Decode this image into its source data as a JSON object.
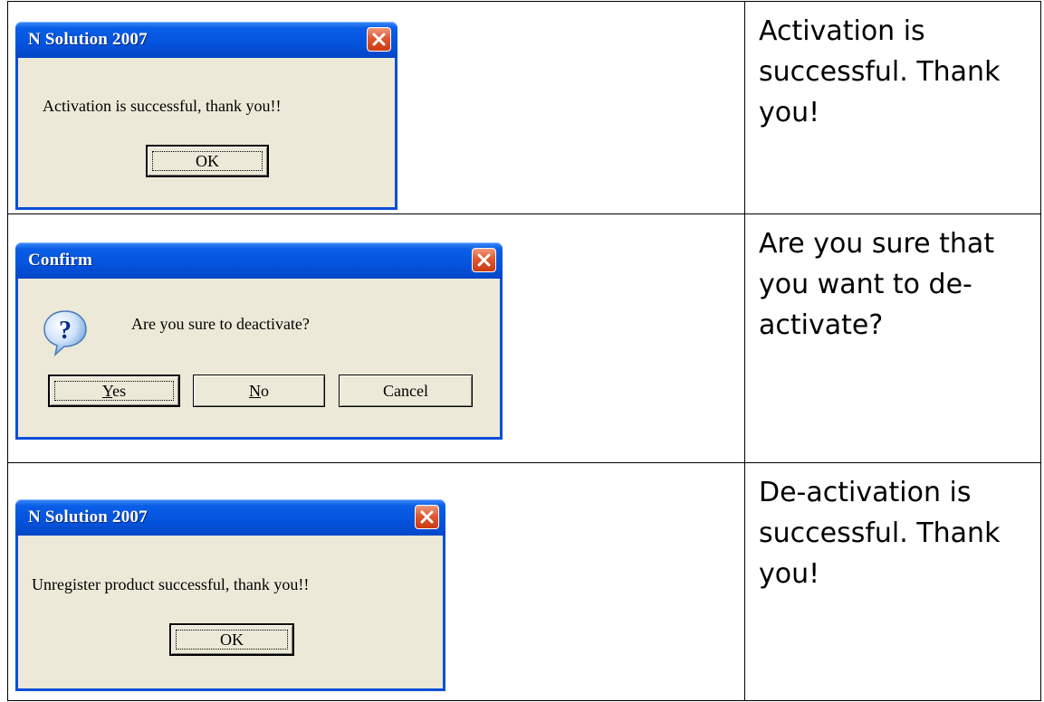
{
  "rows": [
    {
      "dialog": {
        "title": "N Solution 2007",
        "message": "Activation is successful, thank you!!",
        "buttons": [
          {
            "label": "OK"
          }
        ]
      },
      "description": "Activation is successful. Thank you!"
    },
    {
      "dialog": {
        "title": "Confirm",
        "message": "Are you sure to deactivate?",
        "icon": "question-icon",
        "buttons": [
          {
            "mnemonic": "Y",
            "rest": "es"
          },
          {
            "mnemonic": "N",
            "rest": "o"
          },
          {
            "label": "Cancel"
          }
        ]
      },
      "description": "Are you sure that you want to de-activate?"
    },
    {
      "dialog": {
        "title": "N Solution 2007",
        "message": "Unregister product successful, thank you!!",
        "buttons": [
          {
            "label": "OK"
          }
        ]
      },
      "description": "De-activation is successful. Thank you!"
    }
  ],
  "colors": {
    "titlebar": "#0453dc",
    "dialog_face": "#ece9d8",
    "close_button": "#e0582f"
  }
}
